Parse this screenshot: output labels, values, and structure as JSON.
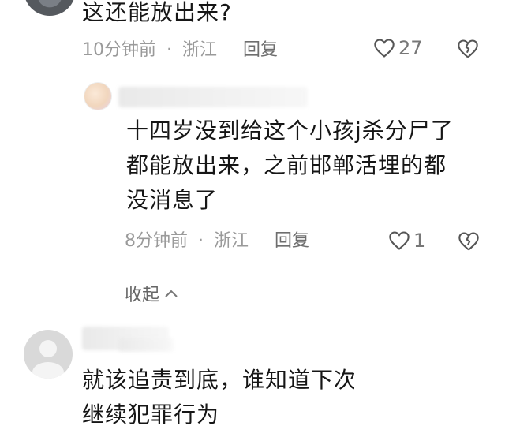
{
  "comments": [
    {
      "text": "这还能放出来?",
      "time": "10分钟前",
      "separator": "·",
      "location": "浙江",
      "reply_label": "回复",
      "likes": "27",
      "icons": {
        "like": "heart-outline-icon",
        "dislike": "broken-heart-icon"
      }
    }
  ],
  "reply": {
    "text_lines": [
      "十四岁没到给这个小孩j杀分尸了",
      "都能放出来，之前邯郸活埋的都",
      "没消息了"
    ],
    "time": "8分钟前",
    "separator": "·",
    "location": "浙江",
    "reply_label": "回复",
    "likes": "1",
    "icons": {
      "like": "heart-outline-icon",
      "dislike": "broken-heart-icon"
    }
  },
  "collapse": {
    "label": "收起",
    "icon": "chevron-up-icon"
  },
  "third_comment": {
    "text_lines": [
      "就该追责到底，谁知道下次",
      "继续犯罪行为"
    ]
  }
}
